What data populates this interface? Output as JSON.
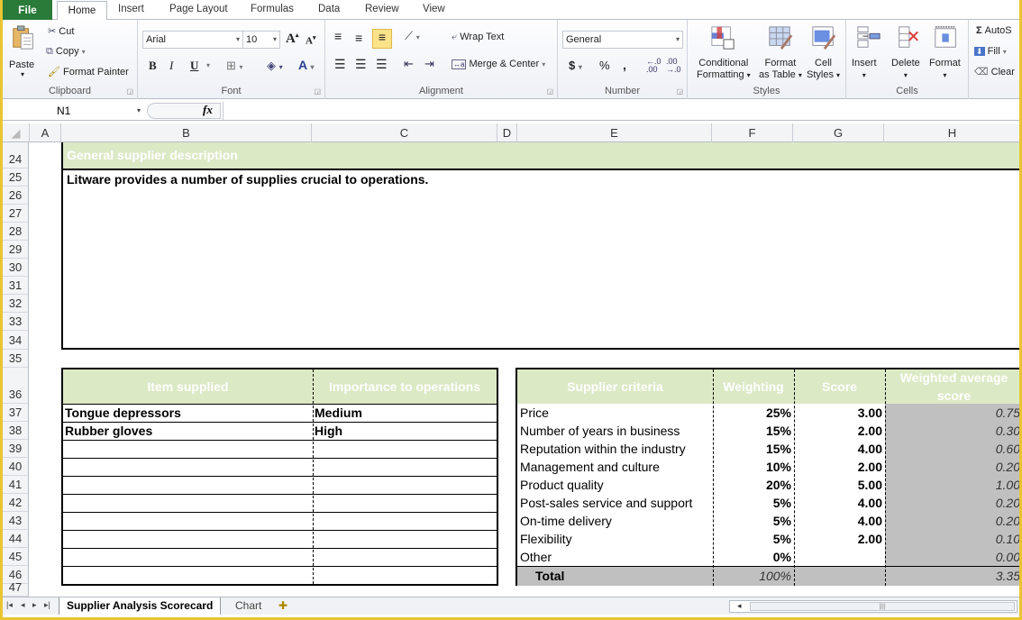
{
  "ribbon_tabs": [
    "File",
    "Home",
    "Insert",
    "Page Layout",
    "Formulas",
    "Data",
    "Review",
    "View"
  ],
  "clipboard": {
    "paste": "Paste",
    "cut": "Cut",
    "copy": "Copy",
    "format_painter": "Format Painter",
    "label": "Clipboard"
  },
  "font": {
    "name": "Arial",
    "size": "10",
    "label": "Font",
    "bold": "B",
    "italic": "I",
    "underline": "U"
  },
  "alignment": {
    "wrap_text": "Wrap Text",
    "merge_center": "Merge & Center",
    "label": "Alignment"
  },
  "number": {
    "format": "General",
    "currency": "$",
    "percent": "%",
    "comma": ",",
    "label": "Number"
  },
  "styles": {
    "conditional_1": "Conditional",
    "conditional_2": "Formatting",
    "format_table_1": "Format",
    "format_table_2": "as Table",
    "cell_styles_1": "Cell",
    "cell_styles_2": "Styles",
    "label": "Styles"
  },
  "cells": {
    "insert": "Insert",
    "delete": "Delete",
    "format": "Format",
    "label": "Cells"
  },
  "editing": {
    "autosum": "AutoS",
    "fill": "Fill",
    "clear": "Clear"
  },
  "formula_bar": {
    "name_box": "N1",
    "fx": "fx",
    "value": ""
  },
  "columns": [
    "A",
    "B",
    "C",
    "D",
    "E",
    "F",
    "G",
    "H"
  ],
  "rows": [
    "24",
    "25",
    "26",
    "27",
    "28",
    "29",
    "30",
    "31",
    "32",
    "33",
    "34",
    "35",
    "36",
    "37",
    "38",
    "39",
    "40",
    "41",
    "42",
    "43",
    "44",
    "45",
    "46",
    "47"
  ],
  "description": {
    "header": "General supplier description",
    "text": "Litware provides a number of supplies crucial to operations."
  },
  "items_table": {
    "headers": [
      "Item supplied",
      "Importance to operations"
    ],
    "rows": [
      [
        "Tongue depressors",
        "Medium"
      ],
      [
        "Rubber gloves",
        "High"
      ],
      [
        "",
        ""
      ],
      [
        "",
        ""
      ],
      [
        "",
        ""
      ],
      [
        "",
        ""
      ],
      [
        "",
        ""
      ],
      [
        "",
        ""
      ],
      [
        "",
        ""
      ],
      [
        "",
        ""
      ]
    ]
  },
  "criteria_table": {
    "headers": [
      "Supplier criteria",
      "Weighting",
      "Score",
      "Weighted average score"
    ],
    "rows": [
      [
        "Price",
        "25%",
        "3.00",
        "0.75"
      ],
      [
        "Number of years in business",
        "15%",
        "2.00",
        "0.30"
      ],
      [
        "Reputation within the industry",
        "15%",
        "4.00",
        "0.60"
      ],
      [
        "Management and culture",
        "10%",
        "2.00",
        "0.20"
      ],
      [
        "Product quality",
        "20%",
        "5.00",
        "1.00"
      ],
      [
        "Post-sales service and support",
        "5%",
        "4.00",
        "0.20"
      ],
      [
        "On-time delivery",
        "5%",
        "4.00",
        "0.20"
      ],
      [
        "Flexibility",
        "5%",
        "2.00",
        "0.10"
      ],
      [
        "Other",
        "0%",
        "",
        "0.00"
      ]
    ],
    "total": [
      "Total",
      "100%",
      "",
      "3.35"
    ]
  },
  "sheet_tabs": [
    "Supplier Analysis Scorecard",
    "Chart"
  ]
}
